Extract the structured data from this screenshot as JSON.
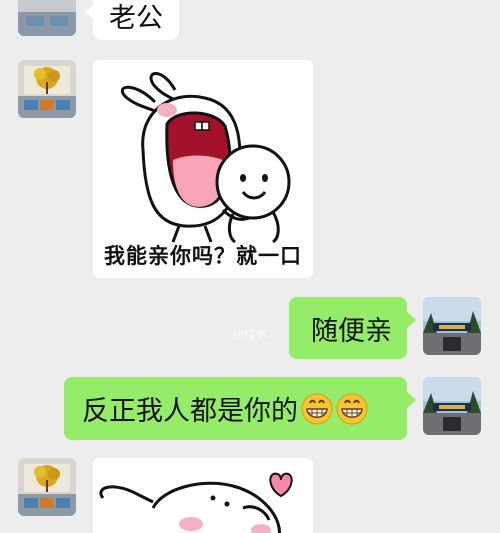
{
  "messages": [
    {
      "from": "other",
      "type": "text",
      "text": "老公"
    },
    {
      "from": "other",
      "type": "sticker",
      "caption": "我能亲你吗？就一口",
      "sticker": "bunny-kissing-face-sticker"
    },
    {
      "from": "me",
      "type": "text",
      "text": "随便亲"
    },
    {
      "from": "me",
      "type": "text",
      "text": "反正我人都是你的",
      "emoji": [
        "grinning-face-emoji",
        "grinning-face-emoji"
      ]
    },
    {
      "from": "other",
      "type": "sticker",
      "caption": "",
      "sticker": "bunny-heart-sticker"
    }
  ],
  "watermark": "小红书",
  "colors": {
    "background": "#ededed",
    "my_bubble": "#95ec69",
    "their_bubble": "#ffffff"
  }
}
